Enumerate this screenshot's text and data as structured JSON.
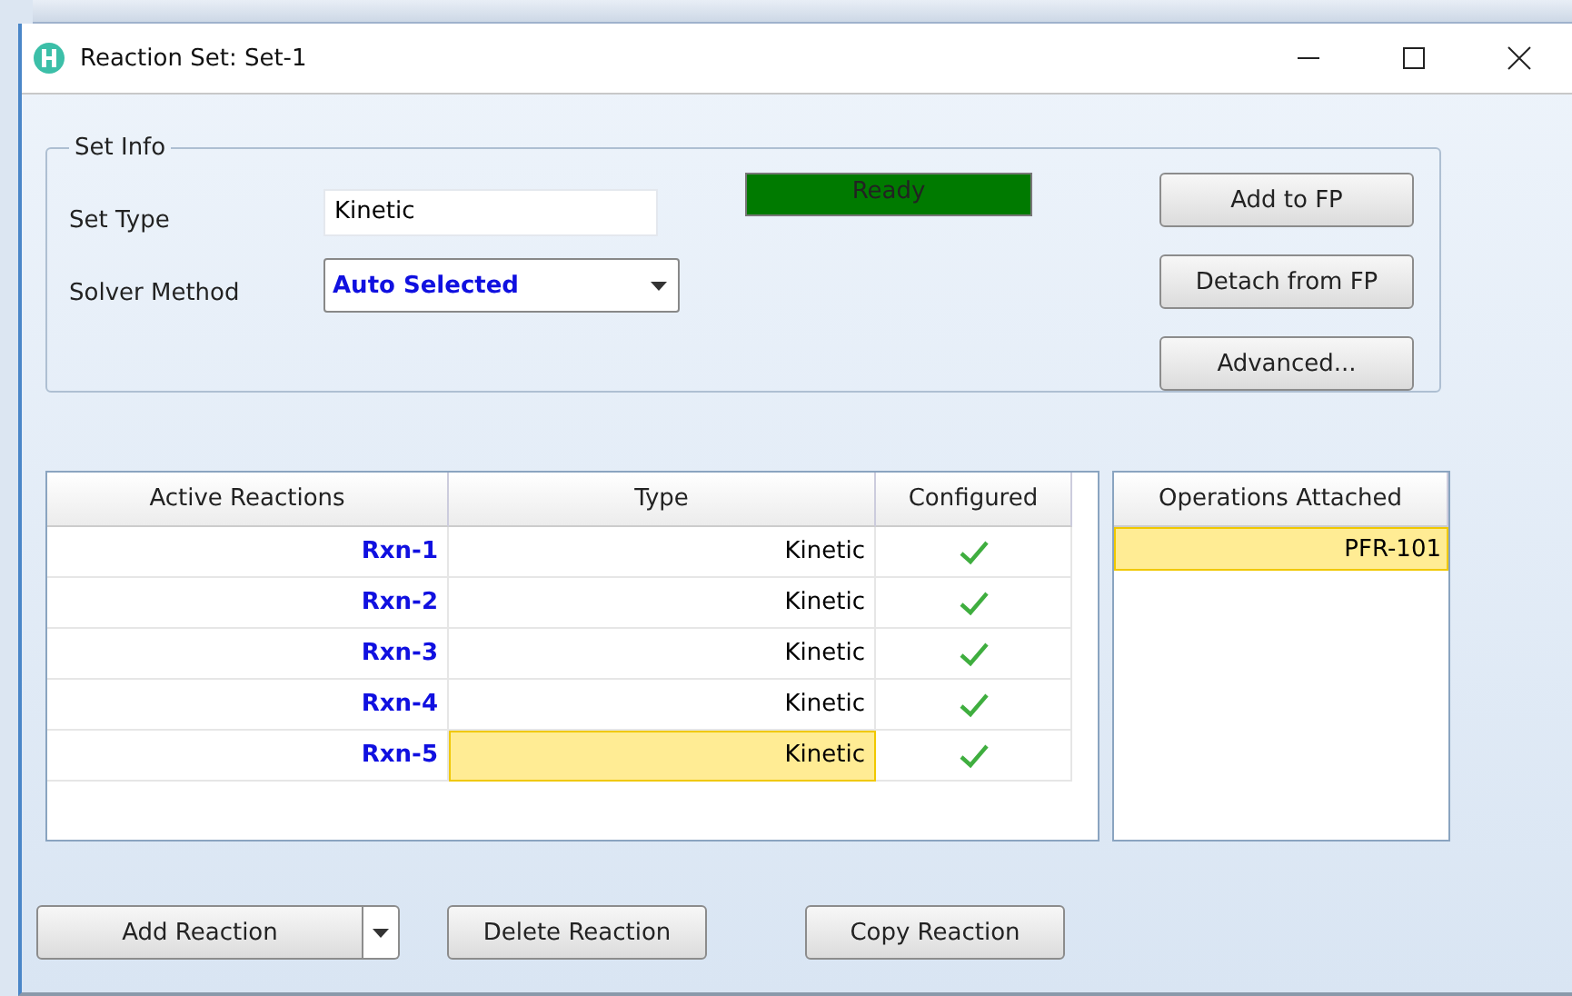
{
  "window": {
    "title": "Reaction Set: Set-1"
  },
  "set_info": {
    "legend": "Set Info",
    "status": "Ready",
    "fields": [
      {
        "label": "Set Type",
        "kind": "text",
        "value": "Kinetic"
      },
      {
        "label": "Solver Method",
        "kind": "dropdown",
        "value": "Auto Selected"
      }
    ],
    "buttons": [
      "Add to FP",
      "Detach from FP",
      "Advanced..."
    ]
  },
  "reactions": {
    "columns": [
      "Active Reactions",
      "Type",
      "Configured"
    ],
    "rows": [
      {
        "name": "Rxn-1",
        "type": "Kinetic",
        "configured": true,
        "selected": false
      },
      {
        "name": "Rxn-2",
        "type": "Kinetic",
        "configured": true,
        "selected": false
      },
      {
        "name": "Rxn-3",
        "type": "Kinetic",
        "configured": true,
        "selected": false
      },
      {
        "name": "Rxn-4",
        "type": "Kinetic",
        "configured": true,
        "selected": false
      },
      {
        "name": "Rxn-5",
        "type": "Kinetic",
        "configured": true,
        "selected": true
      }
    ]
  },
  "operations": {
    "column": "Operations Attached",
    "items": [
      {
        "name": "PFR-101",
        "selected": true
      }
    ]
  },
  "bottom_buttons": [
    {
      "label": "Add Reaction",
      "kind": "split"
    },
    {
      "label": "Delete Reaction",
      "kind": "plain"
    },
    {
      "label": "Copy Reaction",
      "kind": "plain"
    }
  ]
}
